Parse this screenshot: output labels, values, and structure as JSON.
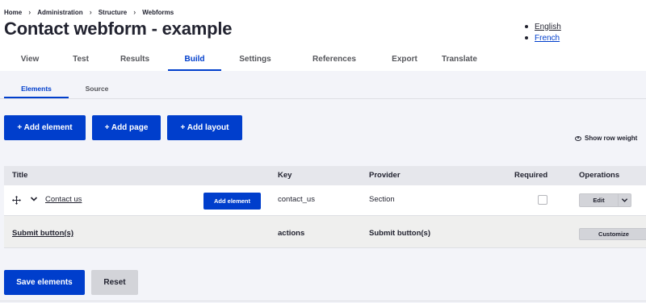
{
  "breadcrumb": [
    "Home",
    "Administration",
    "Structure",
    "Webforms"
  ],
  "page_title": "Contact webform - example",
  "languages": [
    "English",
    "French"
  ],
  "tabs": [
    "View",
    "Test",
    "Results",
    "Build",
    "Settings",
    "References",
    "Export",
    "Translate"
  ],
  "active_tab": "Build",
  "subtabs": [
    "Elements",
    "Source"
  ],
  "active_subtab": "Elements",
  "actions": {
    "add_element": "+ Add element",
    "add_page": "+ Add page",
    "add_layout": "+ Add layout",
    "show_row_weights": "Show row weight"
  },
  "table": {
    "headers": [
      "Title",
      "Key",
      "Provider",
      "Required",
      "Operations"
    ],
    "rows": [
      {
        "title": "Contact us",
        "add_element_label": "Add element",
        "key": "contact_us",
        "provider": "Section",
        "required": false,
        "operation": "Edit"
      },
      {
        "title": "Submit button(s)",
        "key": "actions",
        "provider": "Submit button(s)",
        "operation": "Customize"
      }
    ]
  },
  "footer": {
    "save": "Save elements",
    "reset": "Reset"
  },
  "colors": {
    "accent": "#003ecc",
    "text": "#222330",
    "page_bg": "#f3f4f9",
    "header_bg": "#e6e7ec",
    "secondary_button": "#d3d4d9"
  },
  "icons": [
    "chevron-right-icon",
    "eye-icon",
    "drag-handle-icon",
    "chevron-down-icon"
  ]
}
